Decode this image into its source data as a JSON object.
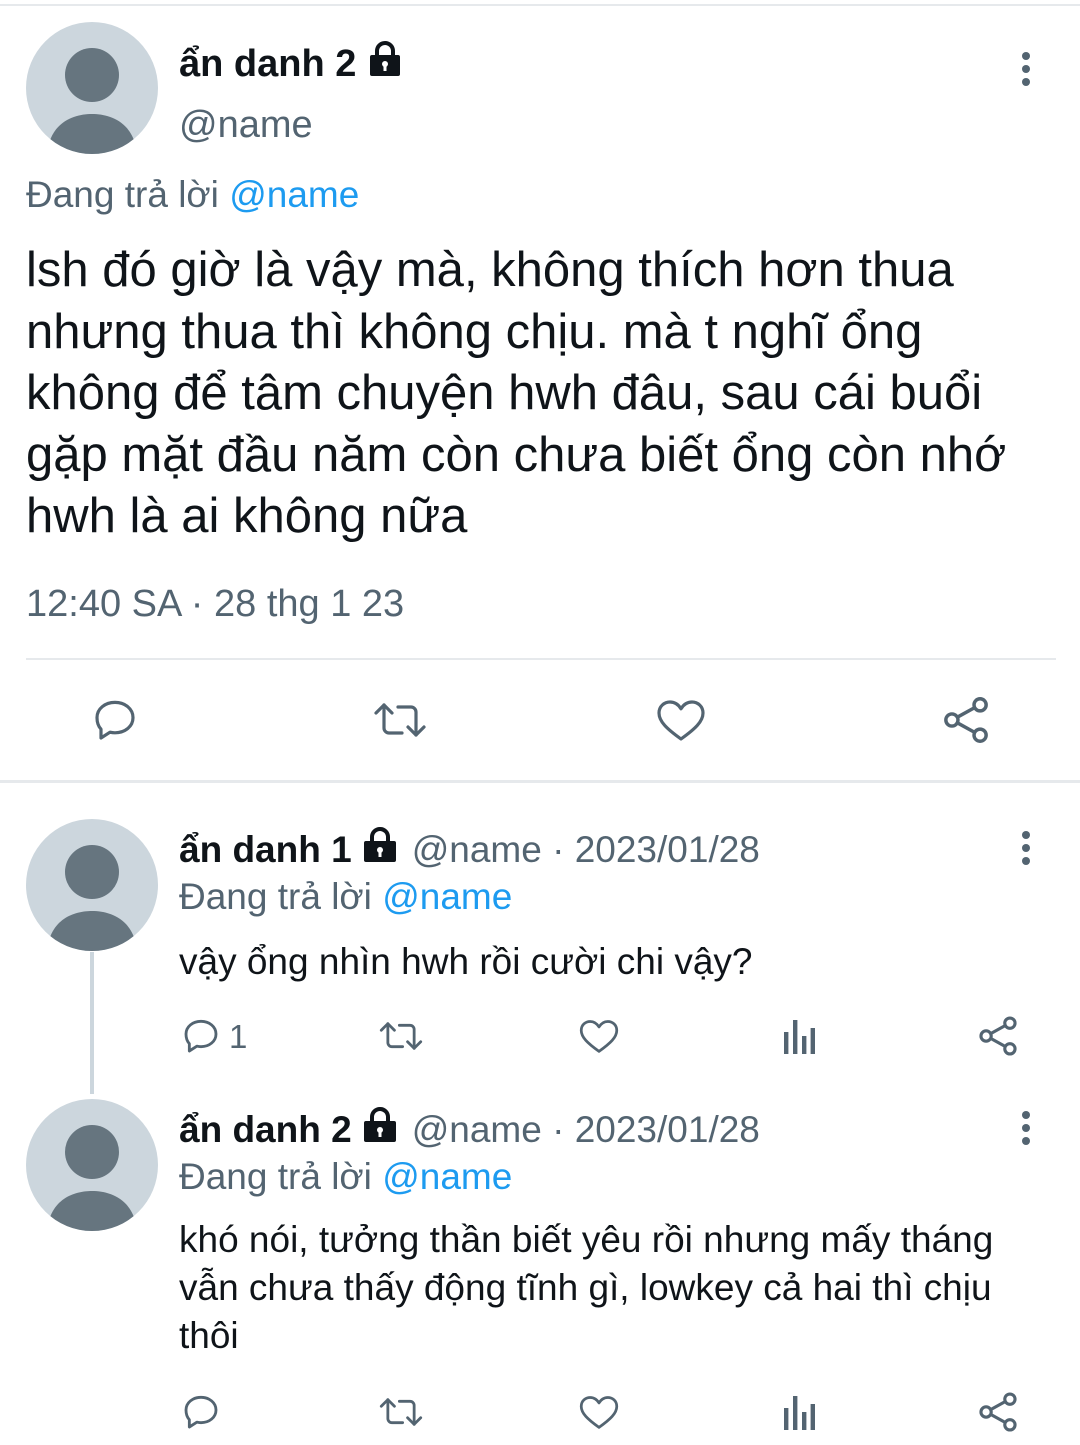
{
  "main": {
    "author_name": "ẩn danh 2",
    "handle": "@name",
    "replying_label": "Đang trả lời",
    "replying_to": "@name",
    "text": "lsh đó giờ là vậy mà, không thích hơn thua nhưng thua thì không chịu. mà t nghĩ ổng không để tâm chuyện hwh đâu, sau cái buổi gặp mặt đầu năm còn chưa biết ổng còn nhớ hwh là ai không nữa",
    "timestamp": "12:40 SA · 28 thg 1 23",
    "actions": [
      "reply-icon",
      "retweet-icon",
      "like-icon",
      "share-icon"
    ]
  },
  "replies": [
    {
      "author_name": "ẩn danh 1",
      "meta": "@name · 2023/01/28",
      "replying_label": "Đang trả lời",
      "replying_to": "@name",
      "text": "vậy ổng nhìn hwh rồi cười chi vậy?",
      "reply_count": "1",
      "actions": [
        "reply-icon",
        "retweet-icon",
        "like-icon",
        "views-icon",
        "share-icon"
      ]
    },
    {
      "author_name": "ẩn danh 2",
      "meta": "@name · 2023/01/28",
      "replying_label": "Đang trả lời",
      "replying_to": "@name",
      "text": "khó nói, tưởng thần biết yêu rồi nhưng mấy tháng vẫn chưa thấy động tĩnh gì, lowkey cả hai thì chịu thôi",
      "actions": [
        "reply-icon",
        "retweet-icon",
        "like-icon",
        "views-icon",
        "share-icon"
      ]
    }
  ],
  "colors": {
    "link": "#1d9bf0",
    "secondary_text": "#536471",
    "primary_text": "#0f1419",
    "avatar_bg": "#ccd6dd",
    "avatar_fg": "#66757f"
  }
}
